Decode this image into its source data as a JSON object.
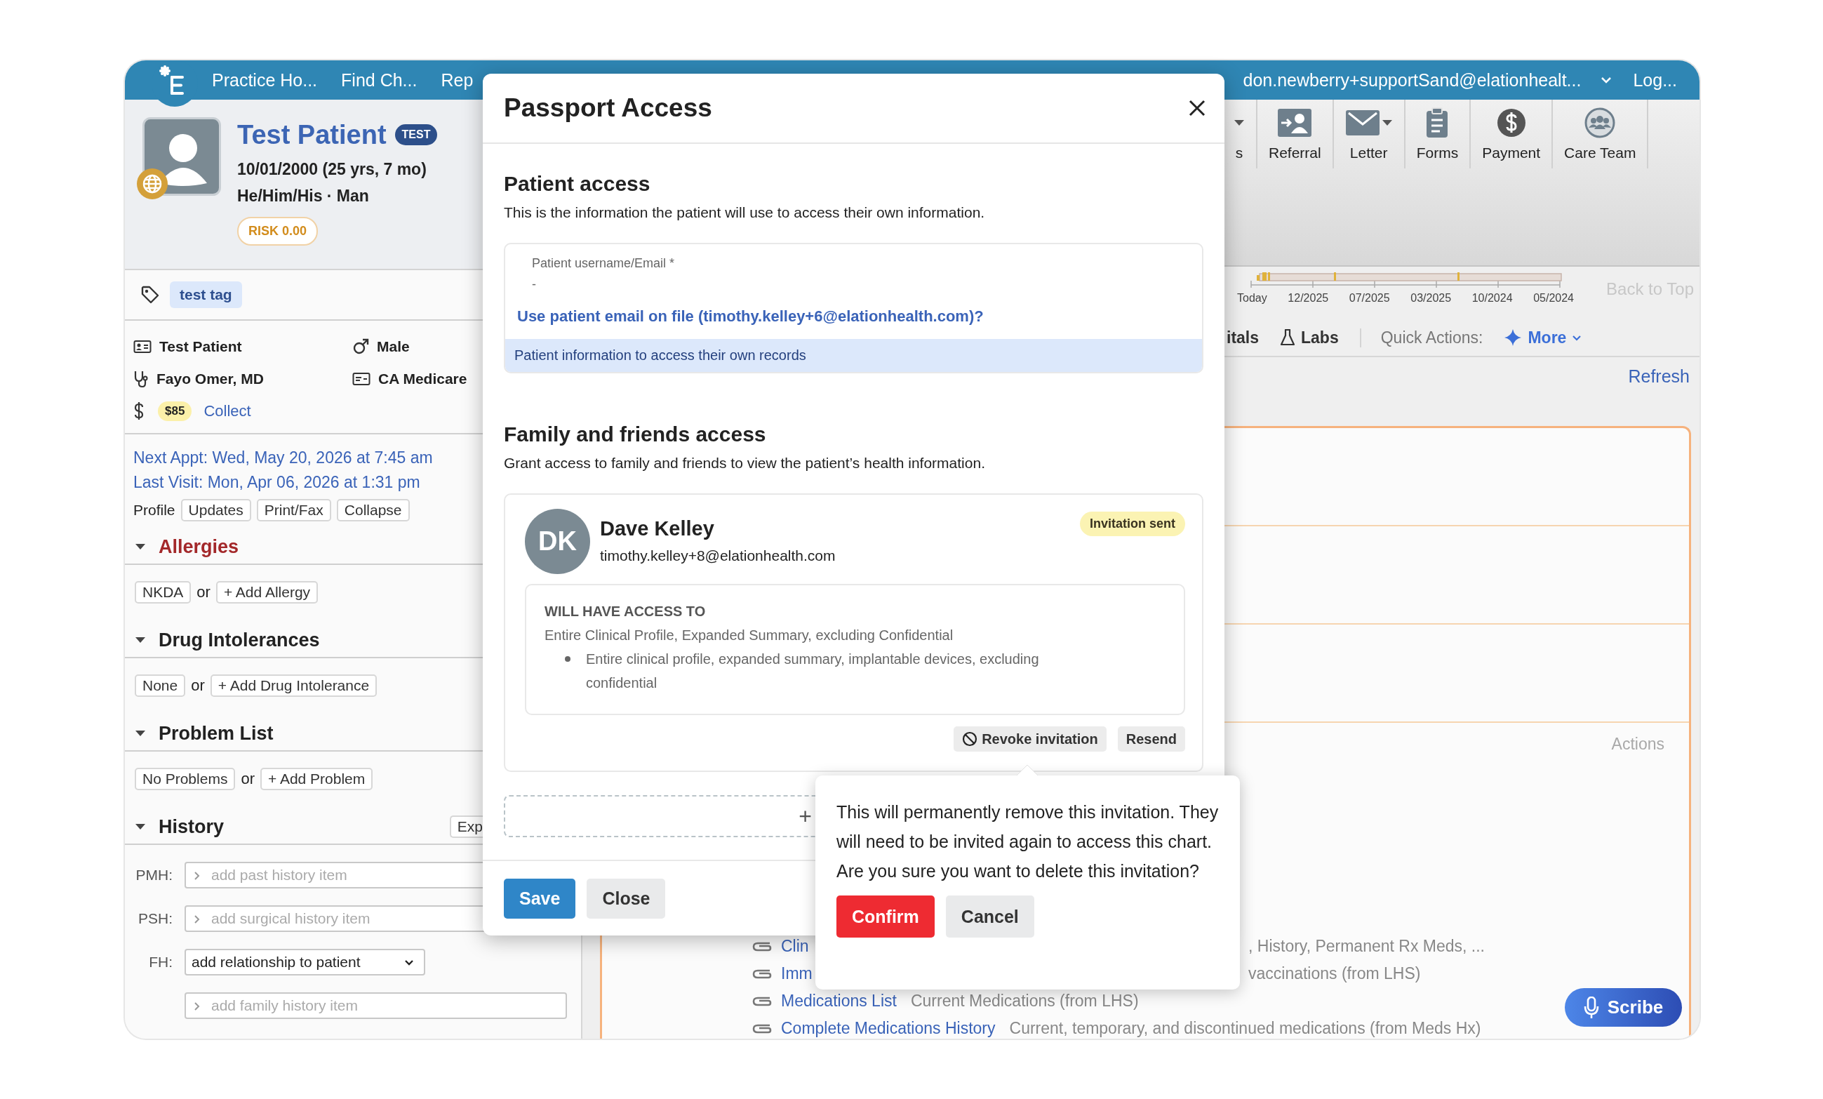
{
  "topbar": {
    "nav": [
      "Practice Ho...",
      "Find Ch...",
      "Rep"
    ],
    "user": "don.newberry+supportSand@elationhealt...",
    "logout": "Log..."
  },
  "patient": {
    "name": "Test Patient",
    "badge": "TEST",
    "dob": "10/01/2000 (25 yrs, 7 mo)",
    "identity": "He/Him/His · Man",
    "risk": "RISK 0.00",
    "tags": [
      "test tag"
    ],
    "facts": [
      {
        "kind": "id",
        "text": "Test Patient"
      },
      {
        "kind": "sex",
        "text": "Male"
      },
      {
        "kind": "provider",
        "text": "Fayo Omer, MD"
      },
      {
        "kind": "insurance",
        "text": "CA Medicare"
      },
      {
        "kind": "balance",
        "amount": "$85",
        "action": "Collect"
      }
    ],
    "next_appt": "Next Appt: Wed, May 20, 2026 at 7:45 am",
    "last_visit": "Last Visit: Mon, Apr 06, 2026 at 1:31 pm",
    "profile": {
      "label": "Profile",
      "buttons": [
        "Updates",
        "Print/Fax",
        "Collapse"
      ]
    }
  },
  "sections": [
    {
      "title": "Allergies",
      "kind": "alert",
      "expanded": true,
      "options": [
        "NKDA",
        "+ Add Allergy"
      ],
      "joiner": "or"
    },
    {
      "title": "Drug Intolerances",
      "kind": "normal",
      "expanded": true,
      "options": [
        "None",
        "+ Add Drug Intolerance"
      ],
      "joiner": "or"
    },
    {
      "title": "Problem List",
      "kind": "normal",
      "expanded": true,
      "options": [
        "No Problems",
        "+ Add Problem"
      ],
      "joiner": "or"
    }
  ],
  "history": {
    "title": "History",
    "expanded": true,
    "button": "Exp",
    "fields": [
      {
        "label": "PMH:",
        "kind": "text",
        "placeholder": "add past history item"
      },
      {
        "label": "PSH:",
        "kind": "text",
        "placeholder": "add surgical history item"
      },
      {
        "label": "FH:",
        "kind": "select",
        "value": "add relationship to patient"
      },
      {
        "kind": "text",
        "placeholder": "add family history item"
      }
    ]
  },
  "toolbar": [
    {
      "label": "s",
      "kind": "partial",
      "dropdown": true
    },
    {
      "label": "Referral",
      "kind": "referral",
      "dropdown": false
    },
    {
      "label": "Letter",
      "kind": "letter",
      "dropdown": true
    },
    {
      "label": "Forms",
      "kind": "forms",
      "dropdown": false
    },
    {
      "label": "Payment",
      "kind": "payment",
      "dropdown": false
    },
    {
      "label": "Care Team",
      "kind": "team",
      "dropdown": false
    }
  ],
  "timeline": {
    "ticks": [
      "Today",
      "12/2025",
      "07/2025",
      "03/2025",
      "10/2024",
      "05/2024"
    ],
    "back_to_top": "Back to Top"
  },
  "chart_tabs": {
    "tabs": [
      {
        "label": "itals",
        "kind": "vitals"
      },
      {
        "label": "Labs",
        "kind": "labs"
      }
    ],
    "quick_actions": "Quick Actions:",
    "more": "More"
  },
  "refresh": "Refresh",
  "summary": {
    "actions_header": "Actions",
    "rows": [
      {
        "kind": "partial",
        "link": "Clin",
        "description": ", History, Permanent Rx Meds, ..."
      },
      {
        "kind": "partial",
        "link": "Imm",
        "description": "vaccinations (from LHS)"
      },
      {
        "kind": "full",
        "link": "Medications List",
        "description": "Current Medications (from LHS)"
      },
      {
        "kind": "full",
        "link": "Complete Medications History",
        "description": "Current, temporary, and discontinued medications (from Meds Hx)"
      }
    ]
  },
  "scribe": "Scribe",
  "modal": {
    "title": "Passport Access",
    "patient_access": {
      "heading": "Patient access",
      "description": "This is the information the patient will use to access their own information.",
      "field": {
        "label": "Patient username/Email *",
        "value": "-"
      },
      "suggestion": "Use patient email on file (timothy.kelley+6@elationhealth.com)?",
      "note": "Patient information to access their own records"
    },
    "family_access": {
      "heading": "Family and friends access",
      "description": "Grant access to family and friends to view the patient’s health information.",
      "invitees": [
        {
          "initials": "DK",
          "name": "Dave Kelley",
          "email": "timothy.kelley+8@elationhealth.com",
          "status": "Invitation sent",
          "access_heading": "WILL HAVE ACCESS TO",
          "access_summary": "Entire Clinical Profile, Expanded Summary, excluding Confidential",
          "access_items": [
            "Entire clinical profile, expanded summary, implantable devices, excluding confidential"
          ],
          "actions": [
            {
              "label": "Revoke invitation",
              "kind": "revoke"
            },
            {
              "label": "Resend",
              "kind": "resend"
            }
          ]
        }
      ],
      "add": "+"
    },
    "buttons": [
      {
        "label": "Save",
        "kind": "primary"
      },
      {
        "label": "Close",
        "kind": "secondary"
      }
    ]
  },
  "popover": {
    "message": "This will permanently remove this invitation. They will need to be invited again to access this chart. Are you sure you want to delete this invitation?",
    "buttons": [
      {
        "label": "Confirm",
        "kind": "danger"
      },
      {
        "label": "Cancel",
        "kind": "secondary"
      }
    ]
  }
}
